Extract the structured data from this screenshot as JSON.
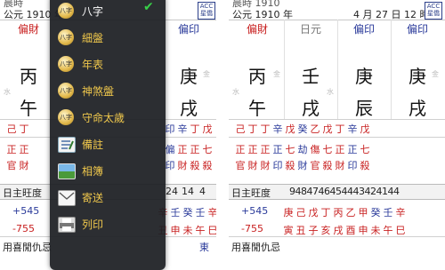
{
  "left": {
    "header_line1": "晨時",
    "header_line2": "公元 1910 年",
    "badge": "ACC 星僑",
    "gods": [
      "偏財",
      "",
      "",
      "偏印"
    ],
    "stems": [
      "丙",
      "",
      "",
      "庚"
    ],
    "branches": [
      "午",
      "",
      "",
      "戌"
    ],
    "elements": [
      "水",
      "金"
    ],
    "hidden_row1": [
      "己",
      "丁",
      "",
      "",
      "",
      "",
      "印",
      "辛",
      "丁",
      "戊"
    ],
    "hidden_row2": [
      "正",
      "正",
      "",
      "",
      "",
      "",
      "偏",
      "正",
      "正",
      "七"
    ],
    "hidden_row3": [
      "官",
      "財",
      "",
      "",
      "",
      "",
      "印",
      "財",
      "殺",
      "殺"
    ],
    "strength_label": "日主旺度",
    "strength_values": [
      "24",
      "14",
      "4"
    ],
    "plus_value": "+545",
    "minus_value": "-755",
    "plus_row": [
      "辛",
      "壬",
      "癸",
      "壬",
      "辛"
    ],
    "minus_row": [
      "丑",
      "申",
      "未",
      "午",
      "巳"
    ],
    "footer": "用喜閒仇忌",
    "footer_blue": "東"
  },
  "right": {
    "header_line1": "晨時 1910",
    "header_line2": "公元 1910 年",
    "header_date": "4 月 27 日 12 時",
    "badge": "ACC 星僑",
    "gods": [
      "偏財",
      "日元",
      "偏印",
      "偏印"
    ],
    "stems": [
      "丙",
      "壬",
      "庚",
      "庚"
    ],
    "branches": [
      "午",
      "戌",
      "辰",
      "戌"
    ],
    "elements": [
      "水",
      "金",
      "水",
      "金"
    ],
    "hidden_row1": [
      "己",
      "丁",
      "丁",
      "辛",
      "戊",
      "癸",
      "乙",
      "戊",
      "丁",
      "辛",
      "戊"
    ],
    "hidden_row2": [
      "正",
      "正",
      "正",
      "正",
      "七",
      "劫",
      "傷",
      "七",
      "正",
      "正",
      "七"
    ],
    "hidden_row3": [
      "官",
      "財",
      "財",
      "印",
      "殺",
      "財",
      "官",
      "殺",
      "財",
      "印",
      "殺"
    ],
    "strength_label": "日主旺度",
    "strength_values": [
      "94",
      "84",
      "74",
      "64",
      "54",
      "44",
      "34",
      "24",
      "14",
      "4"
    ],
    "plus_value": "+545",
    "minus_value": "-755",
    "plus_row": [
      "庚",
      "己",
      "戊",
      "丁",
      "丙",
      "乙",
      "甲",
      "癸",
      "壬",
      "辛"
    ],
    "minus_row": [
      "寅",
      "丑",
      "子",
      "亥",
      "戌",
      "酉",
      "申",
      "未",
      "午",
      "巳"
    ],
    "footer": "用喜閒仇忌"
  },
  "menu": {
    "items": [
      {
        "label": "八字",
        "checked": true
      },
      {
        "label": "細盤"
      },
      {
        "label": "年表"
      },
      {
        "label": "神煞盤"
      },
      {
        "label": "守命太歲"
      },
      {
        "label": "備註"
      },
      {
        "label": "相簿"
      },
      {
        "label": "寄送"
      },
      {
        "label": "列印"
      }
    ],
    "icon_text": "八字",
    "check_mark": "✔"
  },
  "colors": {
    "red": "#c82020",
    "blue": "#2a3a9a",
    "menu_bg": "#1c1e22",
    "gold_label": "#f0c84c"
  }
}
